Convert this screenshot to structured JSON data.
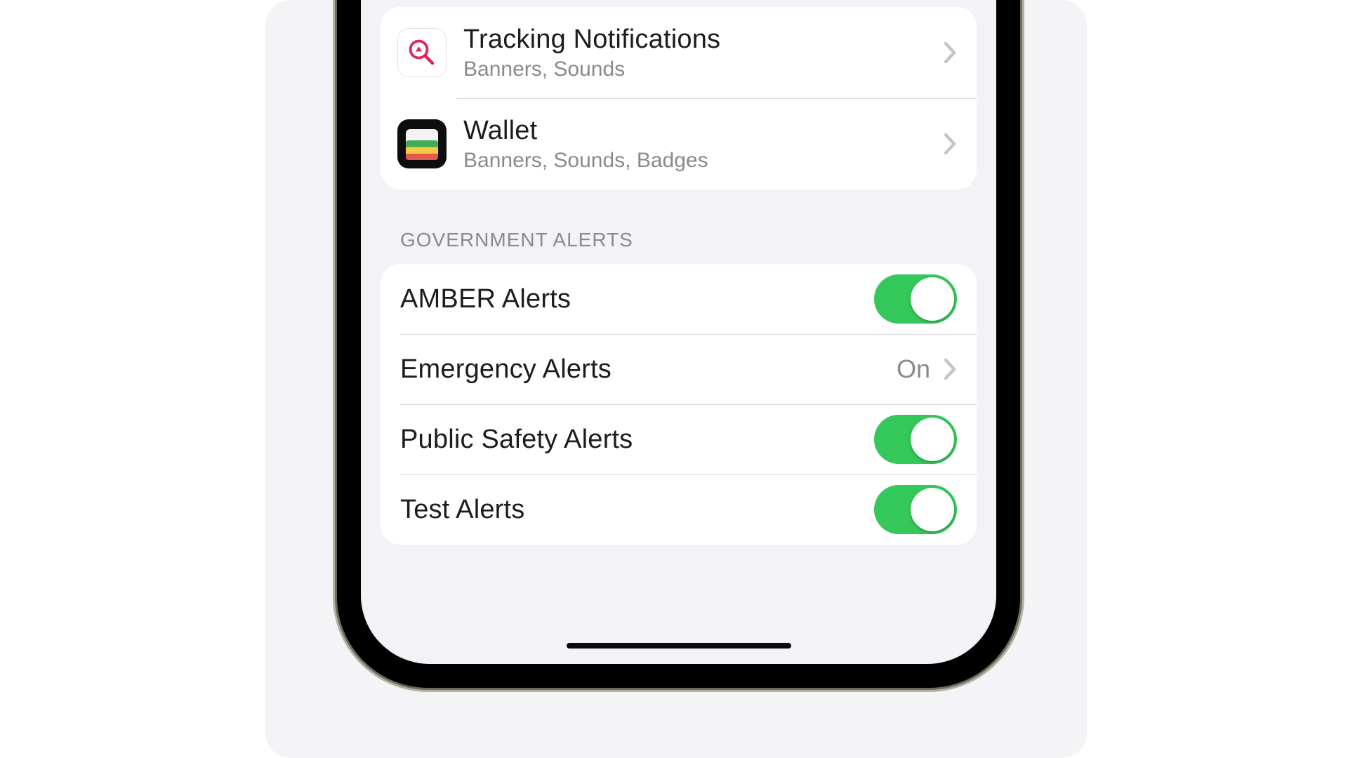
{
  "apps": [
    {
      "title": "Tracking Notifications",
      "subtitle": "Banners, Sounds"
    },
    {
      "title": "Wallet",
      "subtitle": "Banners, Sounds, Badges"
    }
  ],
  "gov_header": "GOVERNMENT ALERTS",
  "gov": {
    "amber": {
      "label": "AMBER Alerts",
      "on": true
    },
    "emerg": {
      "label": "Emergency Alerts",
      "value": "On"
    },
    "safety": {
      "label": "Public Safety Alerts",
      "on": true
    },
    "test": {
      "label": "Test Alerts",
      "on": true
    }
  }
}
